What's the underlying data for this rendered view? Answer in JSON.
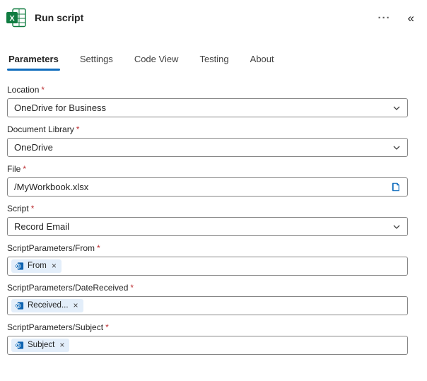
{
  "header": {
    "title": "Run script",
    "more_label": "···",
    "collapse_label": "«",
    "app_icon": "excel-icon"
  },
  "tabs": [
    {
      "label": "Parameters",
      "active": true
    },
    {
      "label": "Settings",
      "active": false
    },
    {
      "label": "Code View",
      "active": false
    },
    {
      "label": "Testing",
      "active": false
    },
    {
      "label": "About",
      "active": false
    }
  ],
  "fields": [
    {
      "label": "Location",
      "required": "*",
      "type": "select",
      "value": "OneDrive for Business"
    },
    {
      "label": "Document Library",
      "required": "*",
      "type": "select",
      "value": "OneDrive"
    },
    {
      "label": "File",
      "required": "*",
      "type": "text",
      "value": "/MyWorkbook.xlsx",
      "icon": "file-picker-icon"
    },
    {
      "label": "Script",
      "required": "*",
      "type": "select",
      "value": "Record Email"
    },
    {
      "label": "ScriptParameters/From",
      "required": "*",
      "type": "token",
      "token": {
        "icon": "outlook-icon",
        "text": "From",
        "remove": "×"
      }
    },
    {
      "label": "ScriptParameters/DateReceived",
      "required": "*",
      "type": "token",
      "token": {
        "icon": "outlook-icon",
        "text": "Received...",
        "remove": "×"
      }
    },
    {
      "label": "ScriptParameters/Subject",
      "required": "*",
      "type": "token",
      "token": {
        "icon": "outlook-icon",
        "text": "Subject",
        "remove": "×"
      }
    }
  ],
  "colors": {
    "accent": "#0f6cbd",
    "required_asterisk": "#bc2f32",
    "token_background": "#e3eefa",
    "input_border": "#868686",
    "excel_green": "#107c41"
  }
}
